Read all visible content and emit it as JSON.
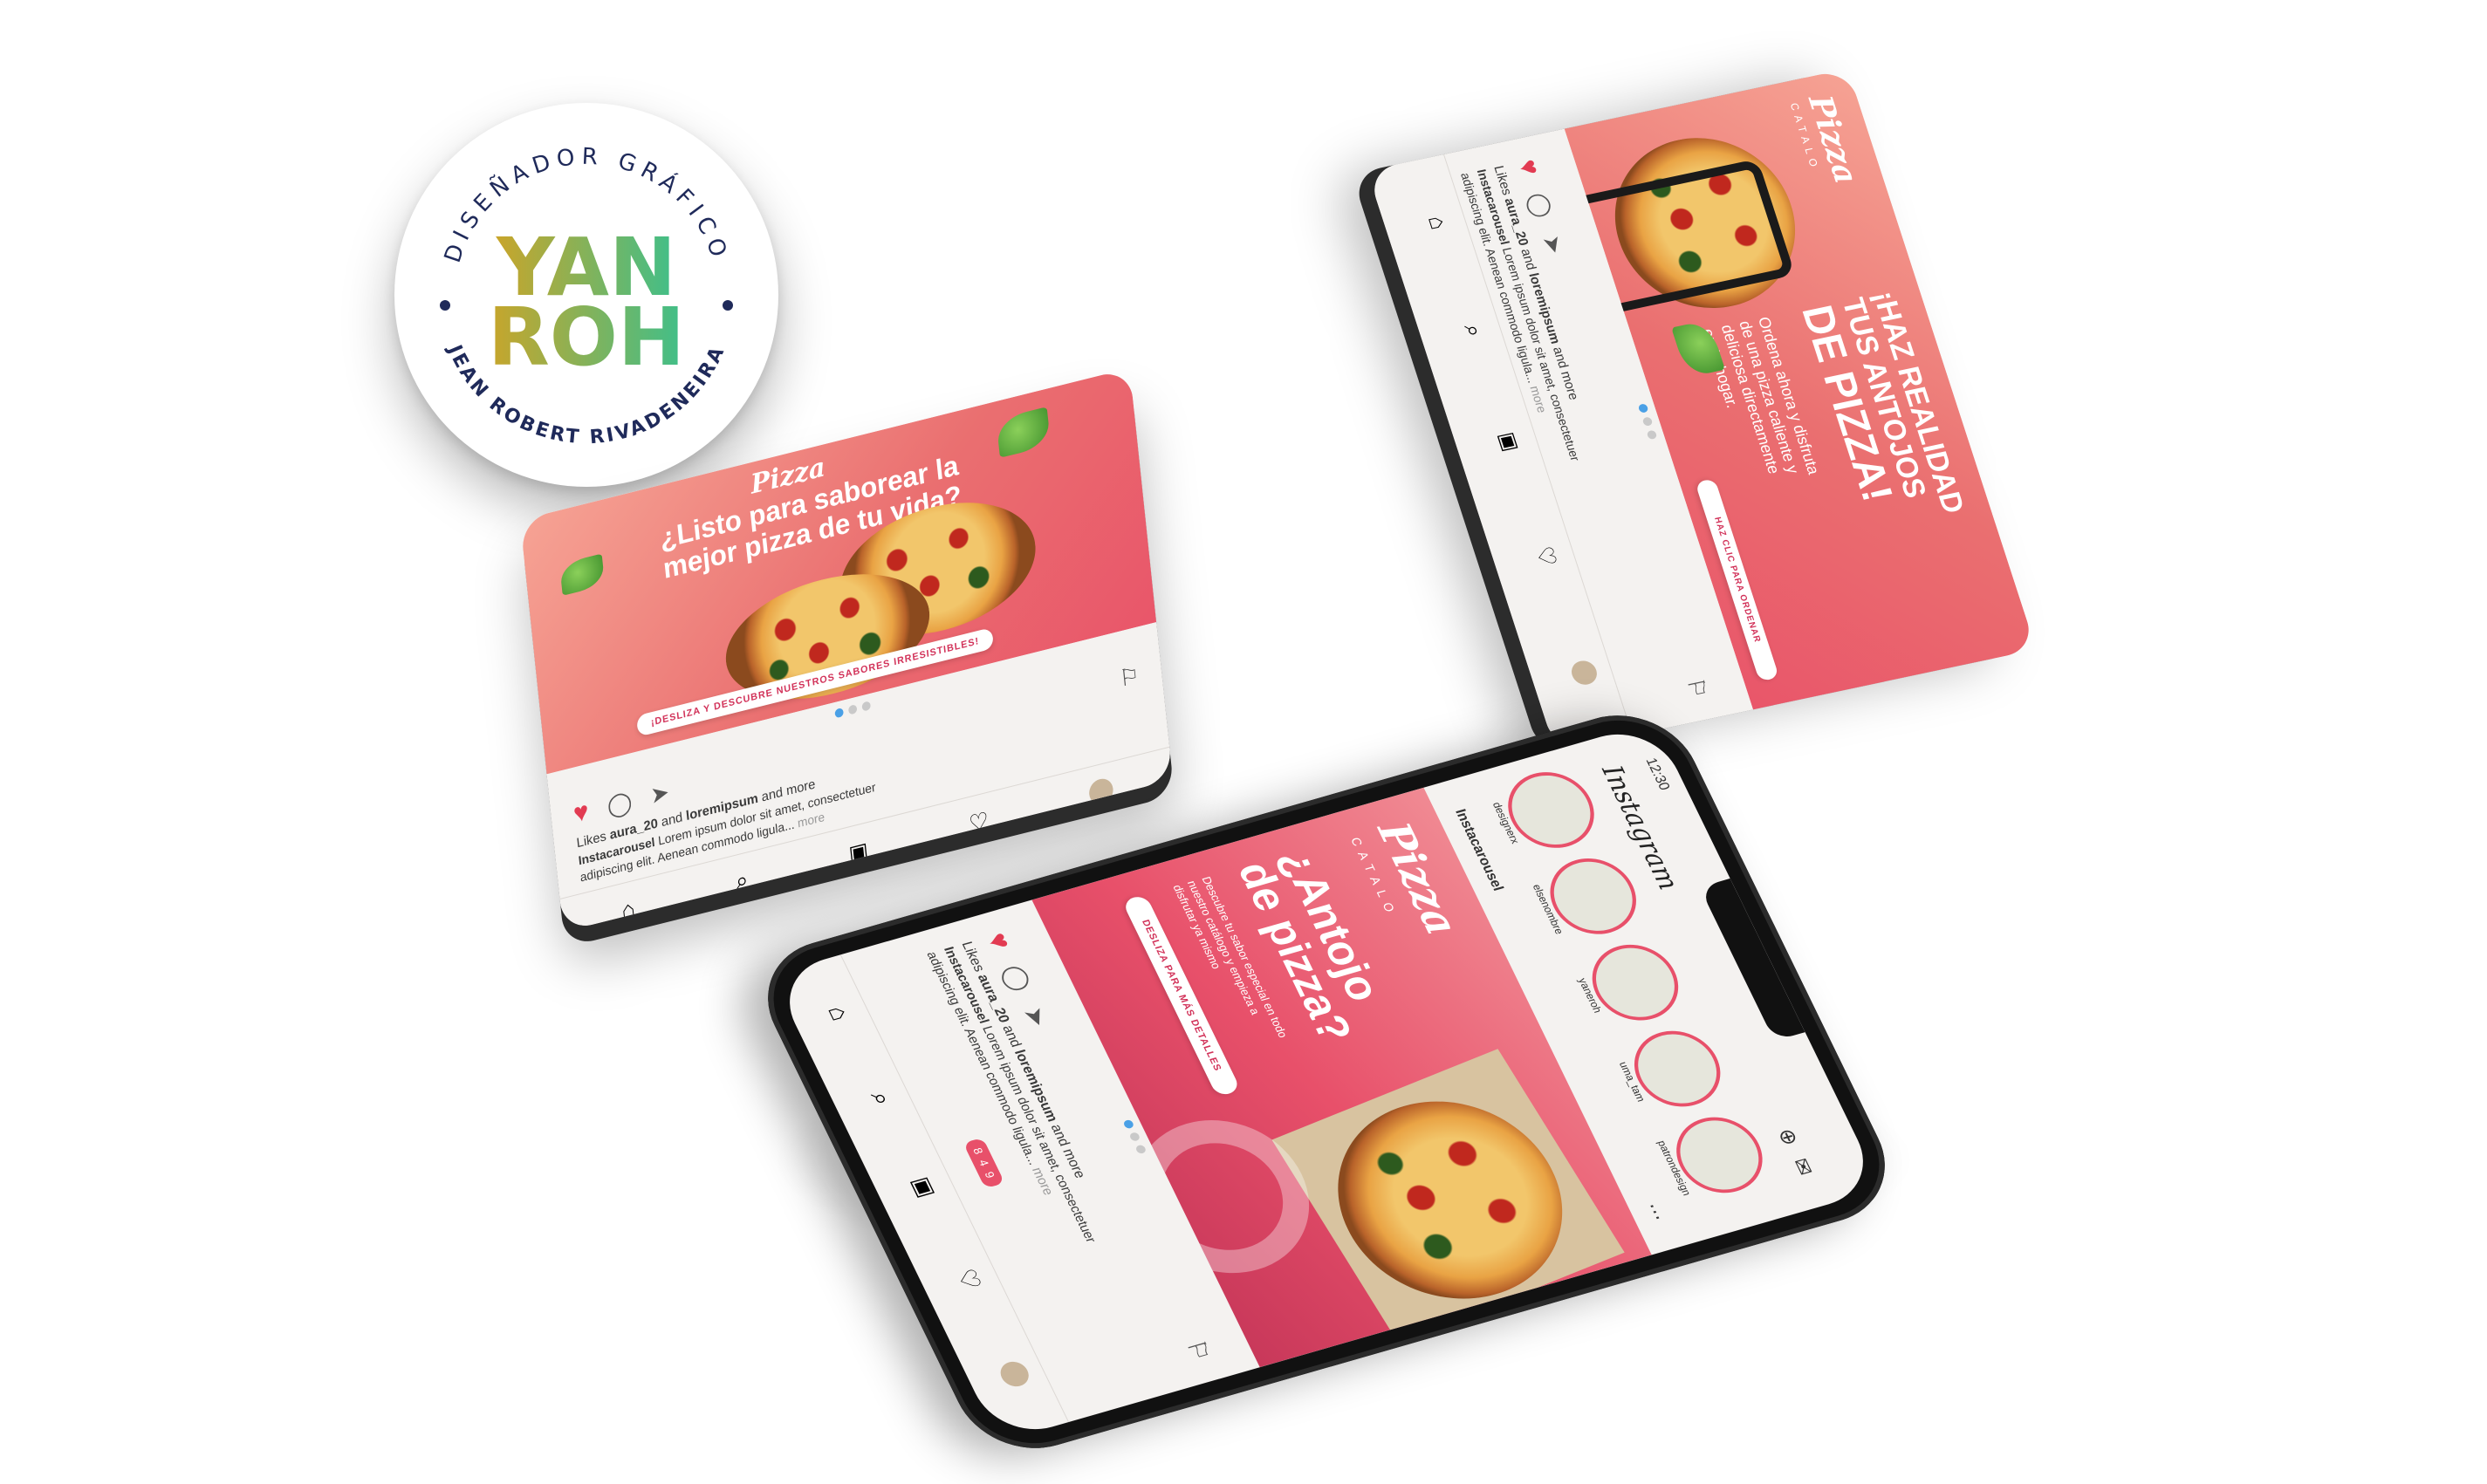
{
  "badge": {
    "top_text": "DISEÑADOR GRÁFICO",
    "bottom_text": "JEAN ROBERT RIVADENEIRA",
    "logo_line1": "YAN",
    "logo_line2": "ROH",
    "colors": {
      "ring_text": "#1f2a5a",
      "logo_start": "#c9a52a",
      "logo_end": "#3fbf8a"
    }
  },
  "left_card": {
    "brand": "Pizza",
    "headline_line1": "¿Listo para saborear la",
    "headline_line2": "mejor pizza de tu vida?",
    "cta": "¡DESLIZA Y DESCUBRE NUESTROS SABORES IRRESISTIBLES!",
    "likes_prefix": "Likes",
    "likes_user1": "aura_20",
    "likes_and": "and",
    "likes_user2": "loremipsum",
    "likes_suffix": "and more",
    "caption_user": "Instacarousel",
    "caption_text1": "Lorem ipsum dolor sit amet, consectetuer",
    "caption_text2": "adipiscing elit. Aenean commodo ligula...",
    "more": "more"
  },
  "right_card": {
    "brand": "Pizza",
    "brand_sub": "CATALO",
    "headline_line1": "¡HAZ REALIDAD",
    "headline_line2": "TUS ANTOJOS",
    "headline_line3": "DE PIZZA!",
    "body_line1": "Ordena ahora y disfruta",
    "body_line2": "de una pizza caliente y",
    "body_line3": "deliciosa directamente",
    "body_line4": "en tu hogar.",
    "cta": "HAZ CLIC PARA ORDENAR",
    "likes_prefix": "Likes",
    "likes_user1": "aura_20",
    "likes_and": "and",
    "likes_user2": "loremipsum",
    "likes_suffix": "and more",
    "caption_user": "Instacarousel",
    "caption_text1": "Lorem ipsum dolor sit amet, consectetuer",
    "caption_text2": "adipiscing elit. Aenean commodo ligula...",
    "more": "more"
  },
  "phone": {
    "status_time": "12:30",
    "app_title": "Instagram",
    "stories": [
      {
        "name": "designerx"
      },
      {
        "name": "elsenombre"
      },
      {
        "name": "yaneroh"
      },
      {
        "name": "uma_tam"
      },
      {
        "name": "patrondesign"
      }
    ],
    "post_user": "Instacarousel",
    "brand": "Pizza",
    "brand_sub": "CATALO",
    "headline_line1": "¿Antojo",
    "headline_line2": "de pizza?",
    "body_line1": "Descubre tu sabor especial en todo",
    "body_line2": "nuestro catálogo y empieza a",
    "body_line3": "disfrutar ya mismo",
    "cta": "DESLIZA PARA MÁS DETALLES",
    "likes_prefix": "Likes",
    "likes_user1": "aura_20",
    "likes_and": "and",
    "likes_user2": "loremipsum",
    "likes_suffix": "and more",
    "caption_user": "Instacarousel",
    "caption_text1": "Lorem ipsum dolor sit amet, consectetuer",
    "caption_text2": "adipiscing elit. Aenean commodo ligula...",
    "more": "more",
    "notif_counts": [
      "8",
      "4",
      "9"
    ],
    "accent": "#e8506a"
  }
}
